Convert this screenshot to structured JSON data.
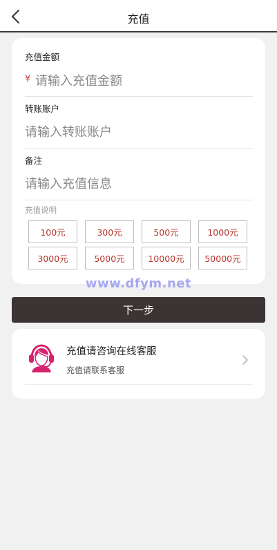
{
  "header": {
    "title": "充值"
  },
  "form": {
    "amount_label": "充值金额",
    "currency_symbol": "¥",
    "amount_placeholder": "请输入充值金额",
    "account_label": "转账账户",
    "account_placeholder": "请输入转账账户",
    "note_label": "备注",
    "note_placeholder": "请输入充值信息",
    "description_label": "充值说明",
    "amounts": [
      "100元",
      "300元",
      "500元",
      "1000元",
      "3000元",
      "5000元",
      "10000元",
      "50000元"
    ]
  },
  "watermark": "www.dfym.net",
  "next_button": "下一步",
  "service": {
    "title": "充值请咨询在线客服",
    "subtitle": "充值请联系客服"
  },
  "colors": {
    "accent_red": "#b5342b",
    "button_dark": "#3c3434",
    "avatar_pink": "#d6236f"
  }
}
